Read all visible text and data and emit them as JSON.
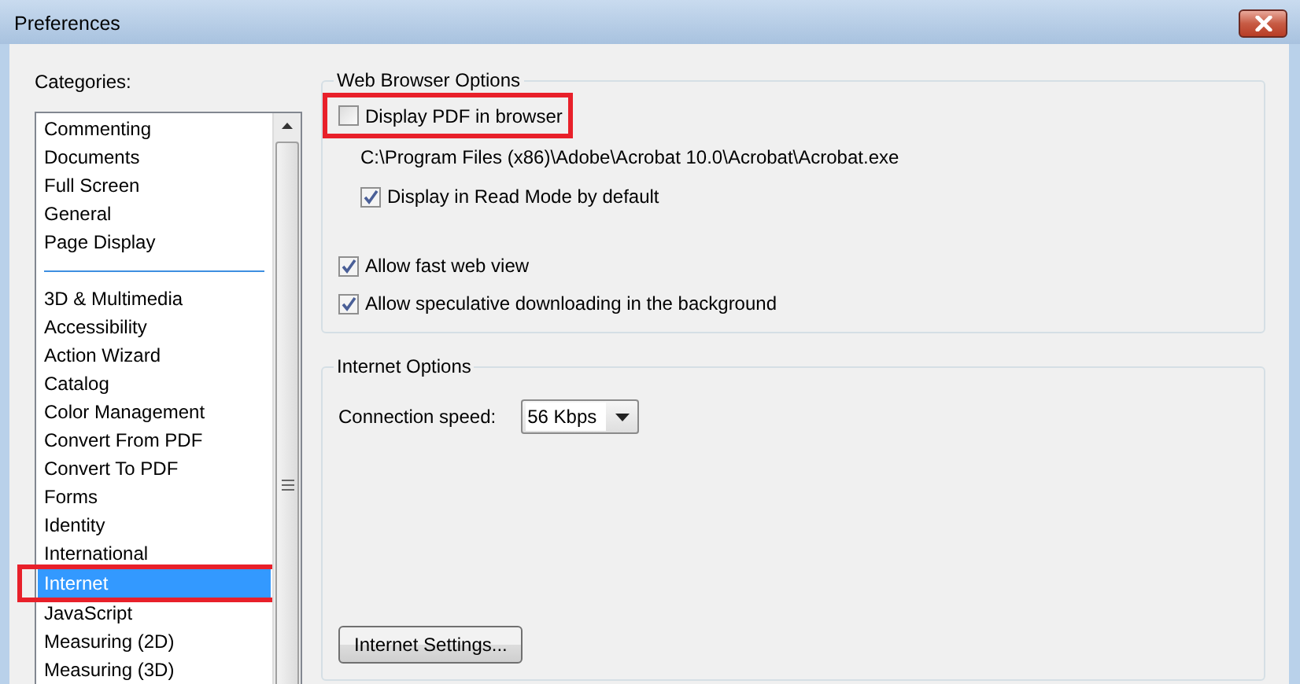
{
  "window": {
    "title": "Preferences"
  },
  "categories": {
    "label": "Categories:",
    "groups": [
      {
        "items": [
          {
            "label": "Commenting",
            "selected": false,
            "highlighted": false
          },
          {
            "label": "Documents",
            "selected": false,
            "highlighted": false
          },
          {
            "label": "Full Screen",
            "selected": false,
            "highlighted": false
          },
          {
            "label": "General",
            "selected": false,
            "highlighted": false
          },
          {
            "label": "Page Display",
            "selected": false,
            "highlighted": false
          }
        ]
      },
      {
        "items": [
          {
            "label": "3D & Multimedia",
            "selected": false,
            "highlighted": false
          },
          {
            "label": "Accessibility",
            "selected": false,
            "highlighted": false
          },
          {
            "label": "Action Wizard",
            "selected": false,
            "highlighted": false
          },
          {
            "label": "Catalog",
            "selected": false,
            "highlighted": false
          },
          {
            "label": "Color Management",
            "selected": false,
            "highlighted": false
          },
          {
            "label": "Convert From PDF",
            "selected": false,
            "highlighted": false
          },
          {
            "label": "Convert To PDF",
            "selected": false,
            "highlighted": false
          },
          {
            "label": "Forms",
            "selected": false,
            "highlighted": false
          },
          {
            "label": "Identity",
            "selected": false,
            "highlighted": false
          },
          {
            "label": "International",
            "selected": false,
            "highlighted": false
          },
          {
            "label": "Internet",
            "selected": true,
            "highlighted": true
          },
          {
            "label": "JavaScript",
            "selected": false,
            "highlighted": false
          },
          {
            "label": "Measuring (2D)",
            "selected": false,
            "highlighted": false
          },
          {
            "label": "Measuring (3D)",
            "selected": false,
            "highlighted": false
          }
        ]
      }
    ]
  },
  "web_browser_options": {
    "title": "Web Browser Options",
    "items": [
      {
        "kind": "checkbox",
        "label": "Display PDF in browser",
        "checked": false,
        "highlighted": true,
        "children": [
          {
            "kind": "text",
            "label": "C:\\Program Files (x86)\\Adobe\\Acrobat 10.0\\Acrobat\\Acrobat.exe"
          },
          {
            "kind": "checkbox",
            "label": "Display in Read Mode by default",
            "checked": true,
            "highlighted": false
          }
        ]
      },
      {
        "kind": "checkbox",
        "label": "Allow fast web view",
        "checked": true,
        "highlighted": false
      },
      {
        "kind": "checkbox",
        "label": "Allow speculative downloading in the background",
        "checked": true,
        "highlighted": false
      }
    ]
  },
  "internet_options": {
    "title": "Internet Options",
    "connection_speed": {
      "label": "Connection speed:",
      "value": "56 Kbps"
    },
    "button": "Internet Settings..."
  }
}
